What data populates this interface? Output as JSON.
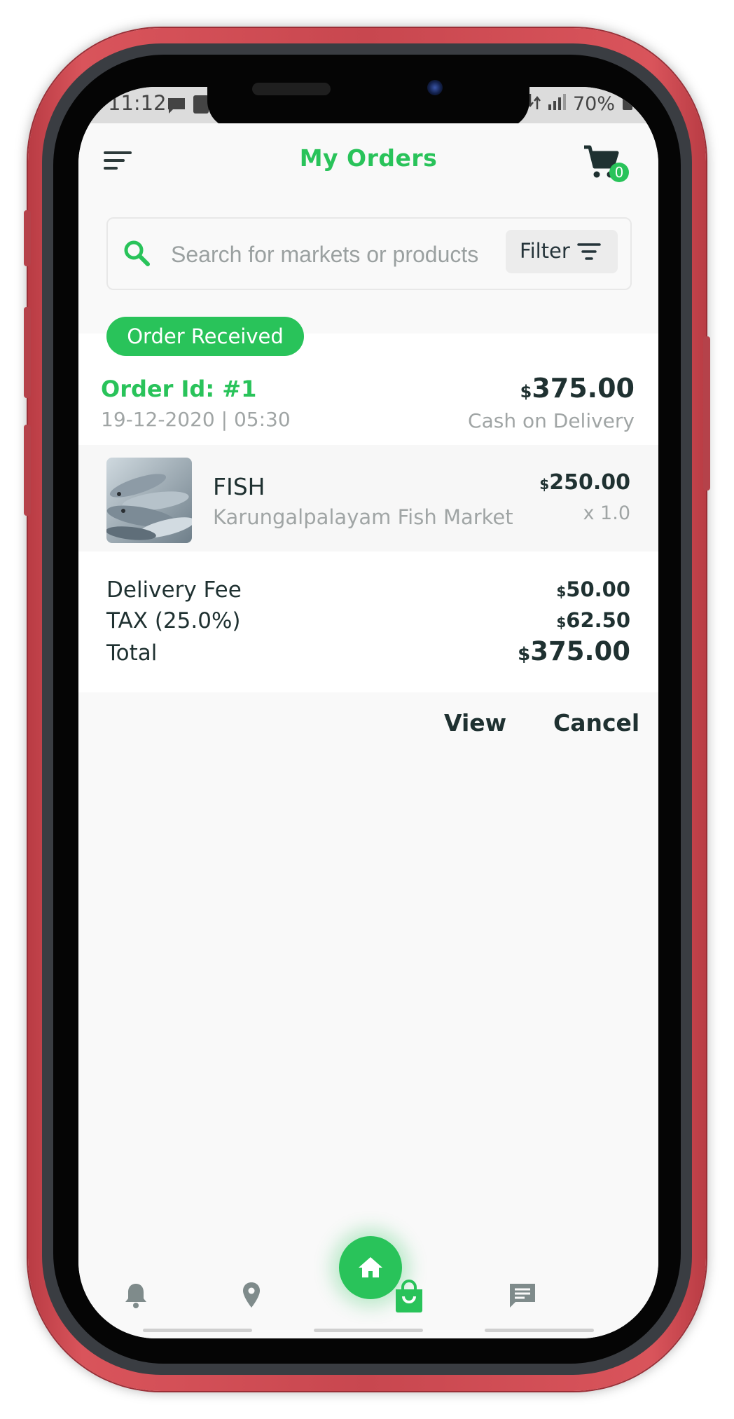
{
  "status_bar": {
    "time": "11:12",
    "battery": "70%"
  },
  "header": {
    "title": "My Orders",
    "cart_count": "0"
  },
  "search": {
    "placeholder": "Search for markets or products",
    "filter_label": "Filter"
  },
  "order": {
    "status": "Order Received",
    "id_label": "Order Id: #1",
    "datetime": "19-12-2020 | 05:30",
    "currency": "$",
    "total": "375.00",
    "payment_method": "Cash on Delivery",
    "items": [
      {
        "name": "FISH",
        "market": "Karungalpalayam Fish Market",
        "price": "250.00",
        "quantity": "x 1.0"
      }
    ],
    "fees": [
      {
        "label": "Delivery Fee",
        "value": "50.00"
      },
      {
        "label": "TAX (25.0%)",
        "value": "62.50"
      }
    ],
    "total_label": "Total"
  },
  "actions": {
    "view": "View",
    "cancel": "Cancel"
  },
  "bottom_nav": [
    "bell-icon",
    "location-pin-icon",
    "home-icon",
    "shopping-bag-icon",
    "chat-icon"
  ],
  "colors": {
    "accent": "#29c35a",
    "text_dark": "#1f3131",
    "text_muted": "#a0a5a5",
    "frame": "#c8474f"
  }
}
